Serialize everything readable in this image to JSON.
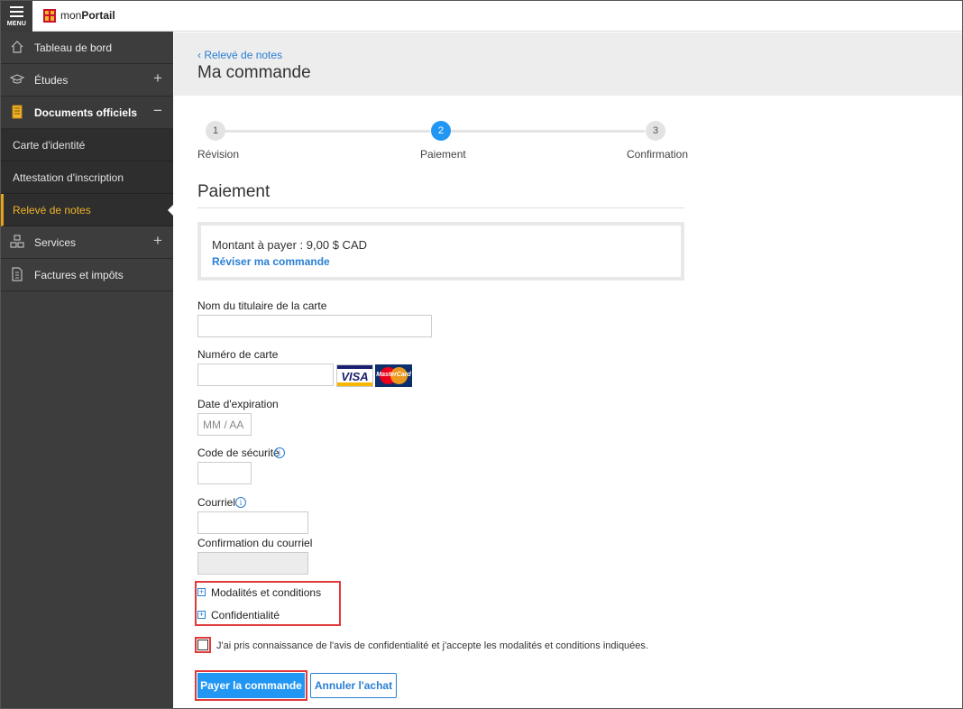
{
  "app": {
    "menu_label": "MENU",
    "brand_prefix": "mon",
    "brand_suffix": "Portail"
  },
  "sidebar": {
    "items": [
      {
        "label": "Tableau de bord",
        "icon": "home-icon",
        "toggle": ""
      },
      {
        "label": "Études",
        "icon": "graduation-cap-icon",
        "toggle": "+"
      },
      {
        "label": "Documents officiels",
        "icon": "document-icon",
        "toggle": "−"
      },
      {
        "label": "Services",
        "icon": "boxes-icon",
        "toggle": "+"
      },
      {
        "label": "Factures et impôts",
        "icon": "invoice-icon",
        "toggle": ""
      }
    ],
    "sub_items": [
      {
        "label": "Carte d'identité"
      },
      {
        "label": "Attestation d'inscription"
      },
      {
        "label": "Relevé de notes"
      }
    ],
    "accent_color": "#f0b429"
  },
  "header": {
    "breadcrumb": "Relevé de notes",
    "title": "Ma commande"
  },
  "stepper": {
    "steps": [
      {
        "number": "1",
        "label": "Révision"
      },
      {
        "number": "2",
        "label": "Paiement"
      },
      {
        "number": "3",
        "label": "Confirmation"
      }
    ],
    "active_color": "#2196f3"
  },
  "payment": {
    "title": "Paiement",
    "amount_label": "Montant à payer :",
    "amount_value": "9,00 $ CAD",
    "review_link": "Réviser ma commande"
  },
  "form": {
    "cardholder_label": "Nom du titulaire de la carte",
    "cardholder_value": "",
    "card_number_label": "Numéro de carte",
    "card_number_value": "",
    "visa_text": "VISA",
    "mastercard_text": "MasterCard",
    "expiry_label": "Date d'expiration",
    "expiry_placeholder": "MM / AA",
    "security_label": "Code de sécurité",
    "email_label": "Courriel",
    "email_confirm_label": "Confirmation du courriel",
    "info_glyph": "i"
  },
  "terms": {
    "conditions_label": "Modalités et conditions",
    "privacy_label": "Confidentialité",
    "expand_glyph": "+",
    "accept_label": "J'ai pris connaissance de l'avis de confidentialité et j'accepte les modalités et conditions indiquées.",
    "accepted": false
  },
  "actions": {
    "pay_label": "Payer la commande",
    "cancel_label": "Annuler l'achat"
  }
}
